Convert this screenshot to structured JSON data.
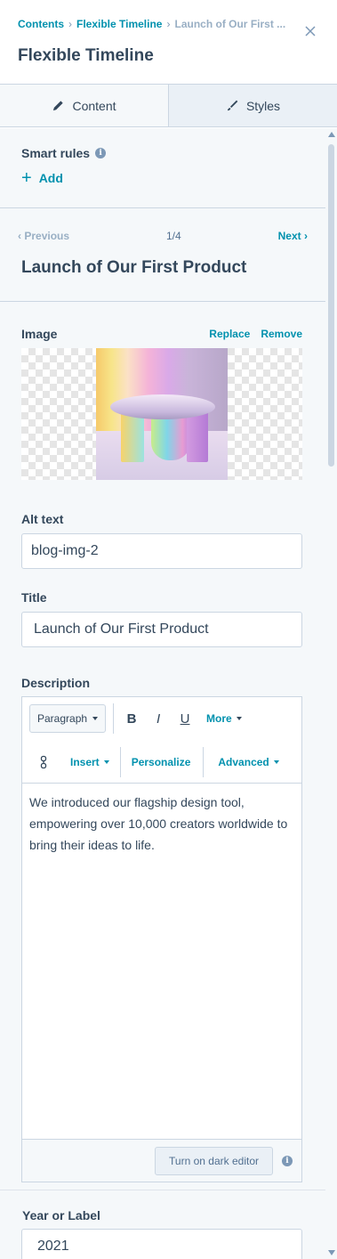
{
  "breadcrumb": {
    "items": [
      "Contents",
      "Flexible Timeline"
    ],
    "current": "Launch of Our First ..."
  },
  "header": {
    "title": "Flexible Timeline"
  },
  "tabs": [
    {
      "label": "Content",
      "icon": "pencil-icon",
      "active": true
    },
    {
      "label": "Styles",
      "icon": "brush-icon",
      "active": false
    }
  ],
  "smart_rules": {
    "label": "Smart rules",
    "add_label": "Add"
  },
  "pager": {
    "previous": "Previous",
    "count": "1/4",
    "next": "Next"
  },
  "item": {
    "title": "Launch of Our First Product"
  },
  "image": {
    "label": "Image",
    "replace": "Replace",
    "remove": "Remove"
  },
  "alt_text": {
    "label": "Alt text",
    "value": "blog-img-2"
  },
  "title_field": {
    "label": "Title",
    "value": "Launch of Our First Product"
  },
  "description": {
    "label": "Description",
    "toolbar": {
      "paragraph": "Paragraph",
      "bold": "B",
      "italic": "I",
      "underline": "U",
      "more": "More",
      "insert": "Insert",
      "personalize": "Personalize",
      "advanced": "Advanced"
    },
    "content": "We introduced our flagship design tool, empowering over 10,000 creators worldwide to bring their ideas to life.",
    "dark_editor": "Turn on dark editor"
  },
  "year": {
    "label": "Year or Label",
    "value": "2021"
  },
  "colors": {
    "accent": "#0091ae",
    "text": "#33475b",
    "border": "#cbd6e2",
    "panel": "#f5f8fa"
  }
}
